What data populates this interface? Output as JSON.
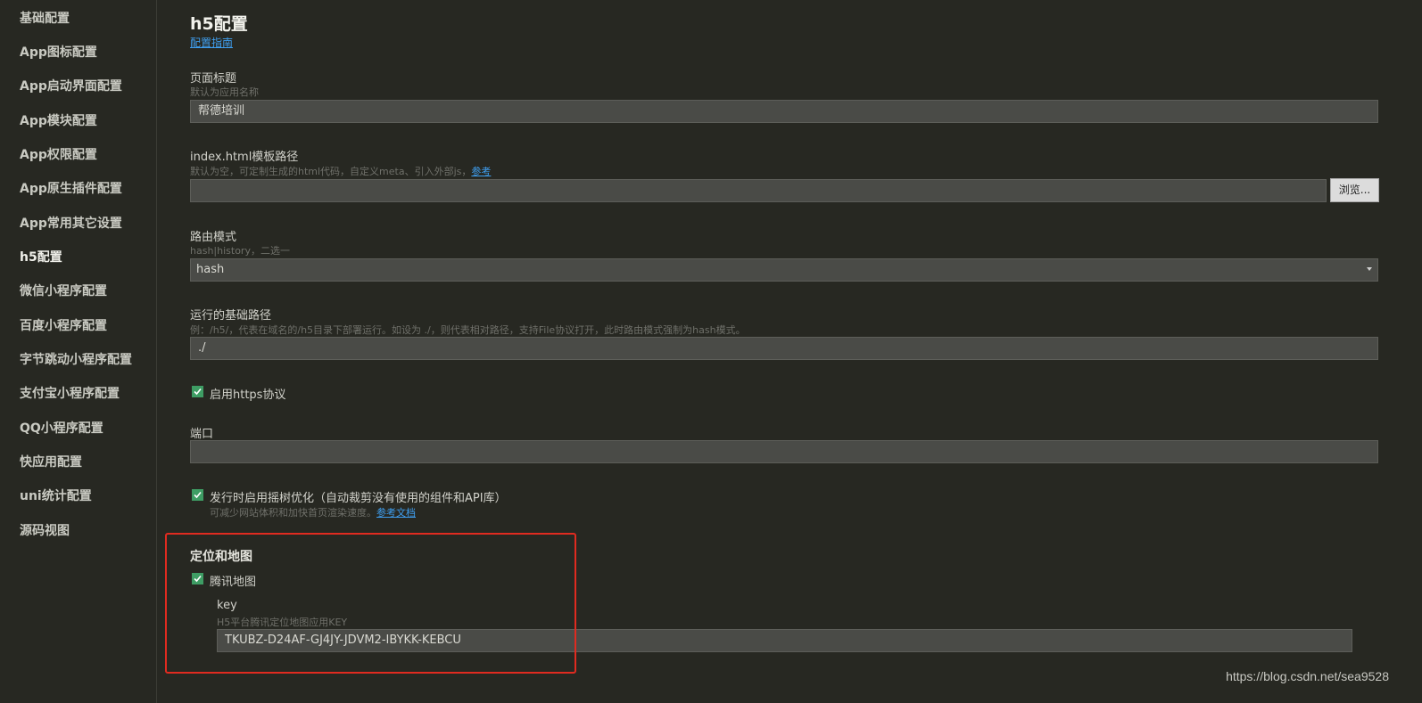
{
  "sidebar": {
    "items": [
      {
        "label": "基础配置"
      },
      {
        "label": "App图标配置"
      },
      {
        "label": "App启动界面配置"
      },
      {
        "label": "App模块配置"
      },
      {
        "label": "App权限配置"
      },
      {
        "label": "App原生插件配置"
      },
      {
        "label": "App常用其它设置"
      },
      {
        "label": "h5配置"
      },
      {
        "label": "微信小程序配置"
      },
      {
        "label": "百度小程序配置"
      },
      {
        "label": "字节跳动小程序配置"
      },
      {
        "label": "支付宝小程序配置"
      },
      {
        "label": "QQ小程序配置"
      },
      {
        "label": "快应用配置"
      },
      {
        "label": "uni统计配置"
      },
      {
        "label": "源码视图"
      }
    ],
    "active": "h5配置"
  },
  "main": {
    "title": "h5配置",
    "guide_link": "配置指南",
    "page_title_field": {
      "label": "页面标题",
      "hint": "默认为应用名称",
      "value": "帮德培训"
    },
    "template_path_field": {
      "label": "index.html模板路径",
      "hint": "默认为空，可定制生成的html代码，自定义meta、引入外部js，",
      "hint_link": "参考",
      "value": "",
      "browse_label": "浏览..."
    },
    "router_mode_field": {
      "label": "路由模式",
      "hint": "hash|history，二选一",
      "value": "hash"
    },
    "base_path_field": {
      "label": "运行的基础路径",
      "hint": "例：/h5/，代表在域名的/h5目录下部署运行。如设为 ./，则代表相对路径，支持File协议打开，此时路由模式强制为hash模式。",
      "value": "./"
    },
    "https_checkbox": {
      "label": "启用https协议",
      "checked": true
    },
    "port_field": {
      "label": "端口",
      "value": ""
    },
    "treeshake_checkbox": {
      "label": "发行时启用摇树优化（自动裁剪没有使用的组件和API库）",
      "hint": "可减少网站体积和加快首页渲染速度。",
      "hint_link": "参考文档",
      "checked": true
    },
    "location_section": {
      "title": "定位和地图",
      "tencent_map_checkbox": {
        "label": "腾讯地图",
        "checked": true
      },
      "key_field": {
        "label": "key",
        "hint": "H5平台腾讯定位地图应用KEY",
        "value": "TKUBZ-D24AF-GJ4JY-JDVM2-IBYKK-KEBCU"
      }
    }
  },
  "watermark": "https://blog.csdn.net/sea9528",
  "colors": {
    "background": "#272822",
    "input_bg": "#4a4b47",
    "link": "#3f9ff0",
    "check": "#3e9d64",
    "highlight": "#e02b20"
  }
}
